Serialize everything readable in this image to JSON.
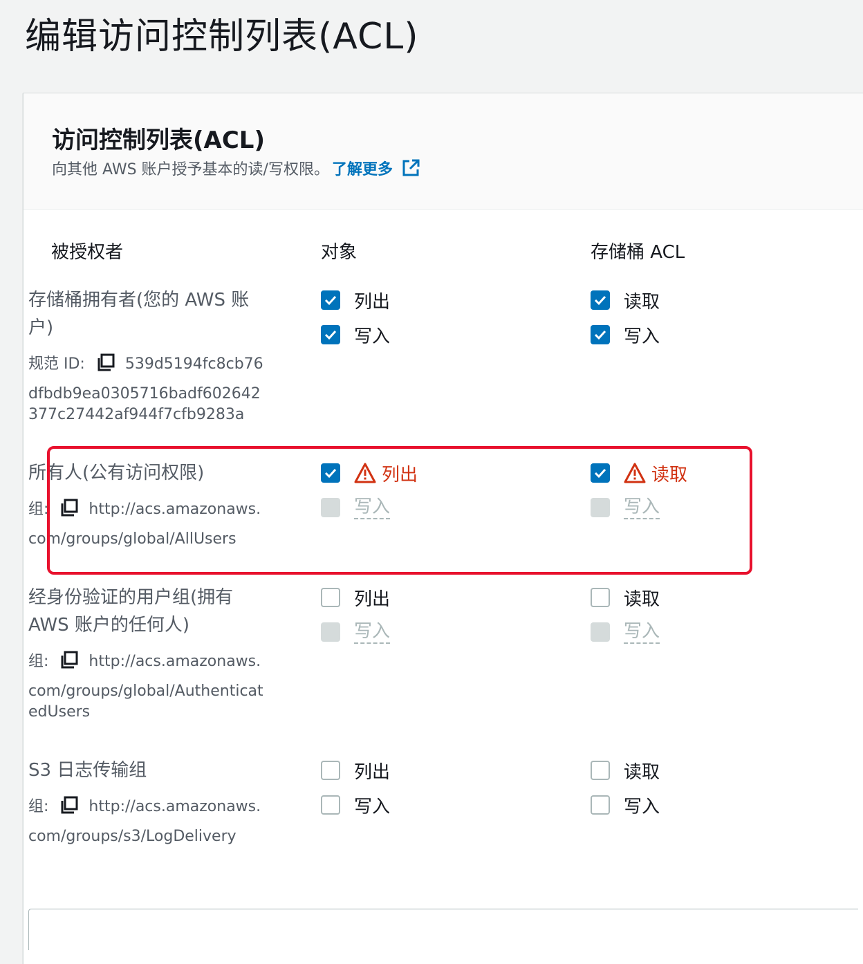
{
  "page": {
    "title": "编辑访问控制列表(ACL)"
  },
  "panel": {
    "title": "访问控制列表(ACL)",
    "description": "向其他 AWS 账户授予基本的读/写权限。",
    "learn_more": "了解更多"
  },
  "columns": {
    "grantee": "被授权者",
    "objects": "对象",
    "bucket_acl": "存储桶 ACL"
  },
  "grantees": [
    {
      "name_line1": "存储桶拥有者(您的 AWS 账",
      "name_line2": "户)",
      "id_label": "规范 ID:",
      "id_line1": "539d5194fc8cb76",
      "id_line2": "dfbdb9ea0305716badf602642",
      "id_line3": "377c27442af944f7cfb9283a",
      "objects": {
        "list": "列出",
        "list_checked": true,
        "write": "写入",
        "write_checked": true
      },
      "bucket": {
        "read": "读取",
        "read_checked": true,
        "write": "写入",
        "write_checked": true
      }
    },
    {
      "name_line1": "所有人(公有访问权限)",
      "id_label": "组:",
      "id_line1": "http://acs.amazonaws.",
      "id_line2": "com/groups/global/AllUsers",
      "objects": {
        "list": "列出",
        "list_checked": true,
        "list_warning": true,
        "write": "写入",
        "write_disabled": true
      },
      "bucket": {
        "read": "读取",
        "read_checked": true,
        "read_warning": true,
        "write": "写入",
        "write_disabled": true
      }
    },
    {
      "name_line1": "经身份验证的用户组(拥有",
      "name_line2": "AWS 账户的任何人)",
      "id_label": "组:",
      "id_line1": "http://acs.amazonaws.",
      "id_line2": "com/groups/global/Authenticat",
      "id_line3": "edUsers",
      "objects": {
        "list": "列出",
        "list_checked": false,
        "write": "写入",
        "write_disabled": true
      },
      "bucket": {
        "read": "读取",
        "read_checked": false,
        "write": "写入",
        "write_disabled": true
      }
    },
    {
      "name_line1": "S3 日志传输组",
      "id_label": "组:",
      "id_line1": "http://acs.amazonaws.",
      "id_line2": "com/groups/s3/LogDelivery",
      "objects": {
        "list": "列出",
        "list_checked": false,
        "write": "写入",
        "write_checked": false
      },
      "bucket": {
        "read": "读取",
        "read_checked": false,
        "write": "写入",
        "write_checked": false
      }
    }
  ],
  "colors": {
    "accent": "#0073bb",
    "warning": "#d13212",
    "highlight": "#e8112d",
    "disabled": "#d5dbdb"
  }
}
